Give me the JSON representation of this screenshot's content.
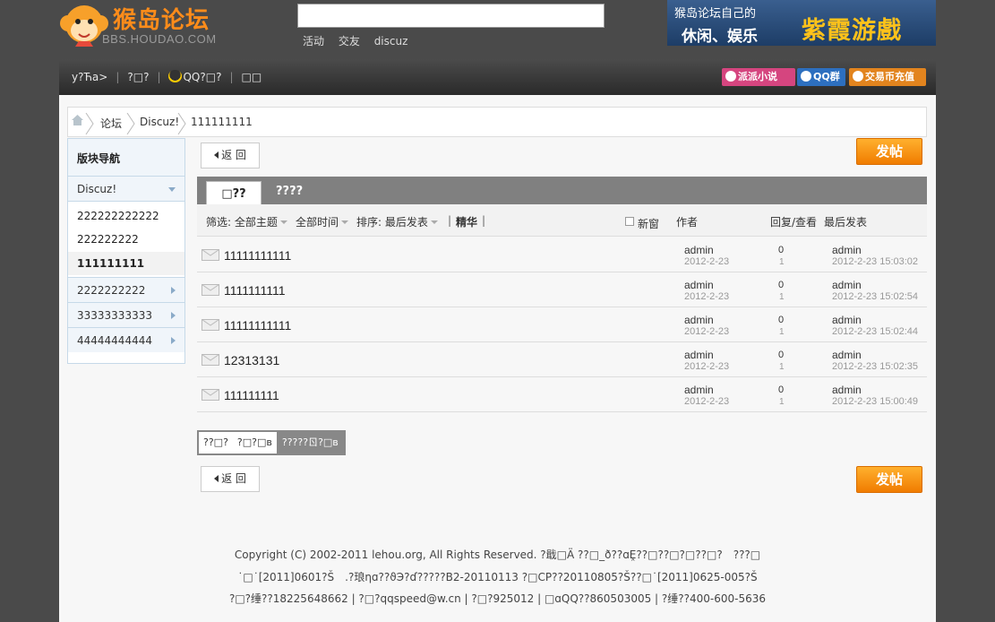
{
  "header": {
    "logo_title": "猴岛论坛",
    "logo_url": "BBS.HOUDAO.COM",
    "search": {
      "value": "",
      "placeholder": ""
    },
    "hot_links": [
      "活动",
      "交友",
      "discuz"
    ],
    "ad": {
      "top_text": "猴岛论坛自己的",
      "bottom_text": "休闲、娱乐",
      "big_text": "紫霞游戲"
    }
  },
  "nav": {
    "items": [
      "у?Ћа>",
      "?□?",
      "QQ?□?",
      "□□"
    ],
    "buttons": {
      "novel": "派派小说",
      "qq_group": "QQ群",
      "trade": "交易币充值"
    }
  },
  "breadcrumb": [
    "论坛",
    "Discuz!",
    "111111111"
  ],
  "sidebar": {
    "title": "版块导航",
    "group": "Discuz!",
    "sub_items": [
      "222222222222",
      "222222222",
      "111111111"
    ],
    "rows": [
      "2222222222",
      "33333333333",
      "44444444444"
    ]
  },
  "actions": {
    "back_label": "返 回",
    "post_label": "发帖"
  },
  "thread_list": {
    "tab_active": "□??",
    "tab_other": "????",
    "filter": {
      "label_filter": "筛选:",
      "all_topics": "全部主题",
      "all_time": "全部时间",
      "label_sort": "排序:",
      "sort_value": "最后发表",
      "digest": "精华",
      "new_window": "新窗"
    },
    "headers": {
      "author": "作者",
      "reply_view": "回复/查看",
      "last_post": "最后发表"
    },
    "rows": [
      {
        "title": "11111111111",
        "author": "admin",
        "date": "2012-2-23",
        "replies": "0",
        "views": "1",
        "last_user": "admin",
        "last_date": "2012-2-23 15:03:02"
      },
      {
        "title": "1111111111",
        "author": "admin",
        "date": "2012-2-23",
        "replies": "0",
        "views": "1",
        "last_user": "admin",
        "last_date": "2012-2-23 15:02:54"
      },
      {
        "title": "11111111111",
        "author": "admin",
        "date": "2012-2-23",
        "replies": "0",
        "views": "1",
        "last_user": "admin",
        "last_date": "2012-2-23 15:02:44"
      },
      {
        "title": "12313131",
        "author": "admin",
        "date": "2012-2-23",
        "replies": "0",
        "views": "1",
        "last_user": "admin",
        "last_date": "2012-2-23 15:02:35"
      },
      {
        "title": "111111111",
        "author": "admin",
        "date": "2012-2-23",
        "replies": "0",
        "views": "1",
        "last_user": "admin",
        "last_date": "2012-2-23 15:00:49"
      }
    ]
  },
  "pager": [
    "??□?",
    "?□?□в",
    "?????ㄖ?□в"
  ],
  "footer": [
    "Copyright (C) 2002-2011 lehou.org, All Rights Reserved. ?戢□Ä ??□_ð??ɑḘ??□??□?□??□?　???□",
    "˙□˙[2011]0601?Š　.?琅ηɑ??ϑЭ?ɗ?????B2-20110113 ?□CP??20110805?Š??□˙[2011]0625-005?Š",
    "?□?缍??18225648662 | ?□?qqspeed@w.cn | ?□?925012 | □ɑQQ??860503005 | ?缍??400-600-5636"
  ],
  "colors": {
    "accent_orange": "#f07c00",
    "nav_dark": "#2a2a2a",
    "tab_gray": "#808080"
  }
}
